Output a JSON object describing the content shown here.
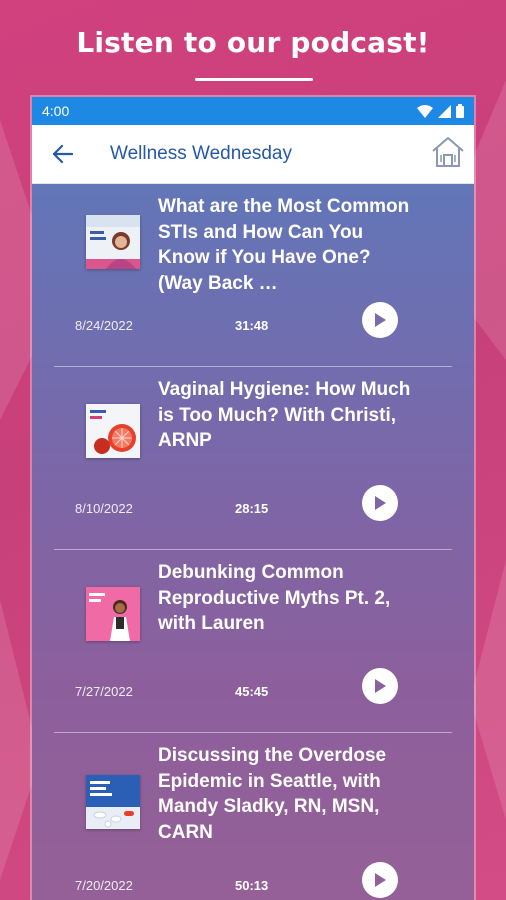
{
  "promo": {
    "title": "Listen to our podcast!"
  },
  "status_bar": {
    "time": "4:00",
    "icons": [
      "wifi-icon",
      "signal-icon",
      "battery-icon"
    ]
  },
  "app_bar": {
    "title": "Wellness Wednesday",
    "back_icon": "arrow-left-icon",
    "home_icon": "home-icon"
  },
  "colors": {
    "accent": "#1e88e5",
    "title": "#2659a9",
    "background": "#d0417e"
  },
  "episodes": [
    {
      "title": "What are the Most Common STIs and How Can You Know if You Have One? (Way Back …",
      "date": "8/24/2022",
      "duration": "31:48",
      "thumb": "woman-portrait-thumbnail"
    },
    {
      "title": "Vaginal Hygiene: How Much is Too Much? With Christi, ARNP",
      "date": "8/10/2022",
      "duration": "28:15",
      "thumb": "grapefruit-thumbnail"
    },
    {
      "title": "Debunking Common Reproductive Myths Pt. 2, with Lauren",
      "date": "7/27/2022",
      "duration": "45:45",
      "thumb": "illustrated-woman-thumbnail"
    },
    {
      "title": "Discussing the Overdose Epidemic in Seattle, with Mandy Sladky, RN, MSN, CARN",
      "date": "7/20/2022",
      "duration": "50:13",
      "thumb": "pills-thumbnail"
    }
  ]
}
